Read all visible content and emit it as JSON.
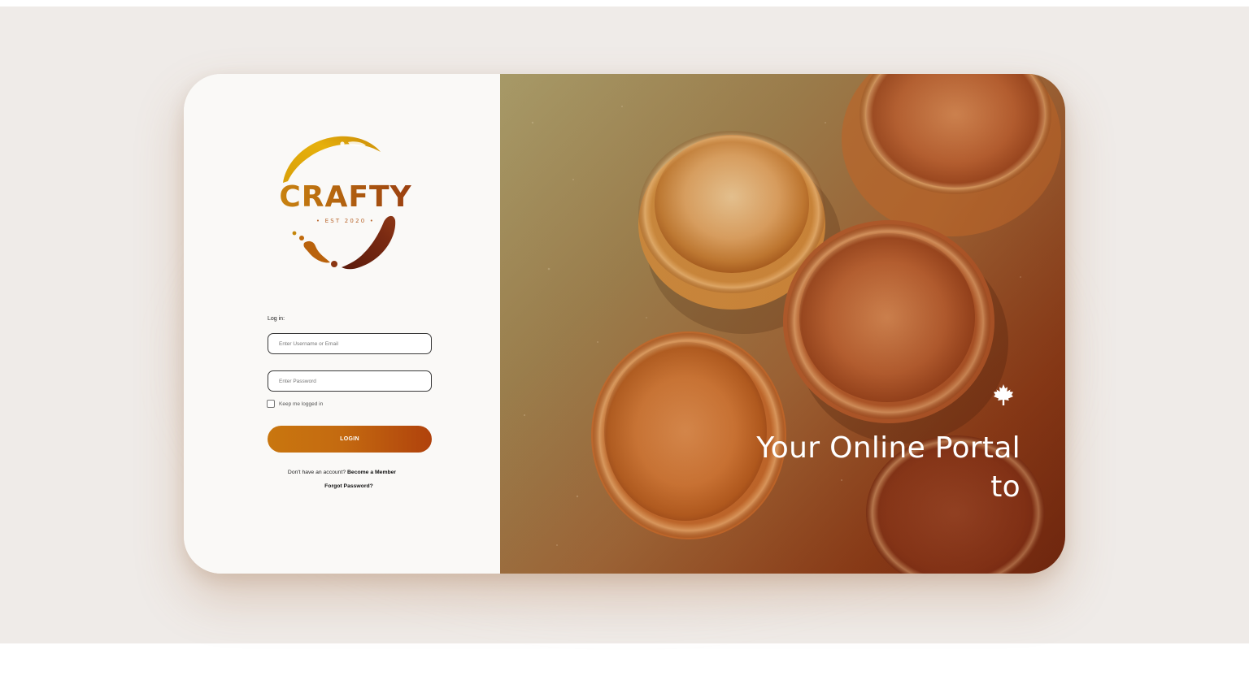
{
  "brand": {
    "logo_text": "CRAFTY",
    "logo_subtext": "• EST 2020 •"
  },
  "login_form": {
    "heading": "Log in:",
    "username_placeholder": "Enter Username or Email",
    "password_placeholder": "Enter Password",
    "keep_logged_in_label": "Keep me logged in",
    "keep_logged_in_checked": false,
    "login_button_label": "LOGIN",
    "signup_prompt": "Don't have an account?",
    "signup_link": "Become a Member",
    "forgot_password_link": "Forgot Password?"
  },
  "hero": {
    "tagline_line1": "Your Online Portal",
    "tagline_line2": "to",
    "icon": "maple-leaf-icon"
  },
  "colors": {
    "button_start": "#c9760f",
    "button_end": "#b0420c",
    "logo_gold": "#e0a106",
    "logo_brown": "#6b2110",
    "page_background": "#efebe8"
  }
}
